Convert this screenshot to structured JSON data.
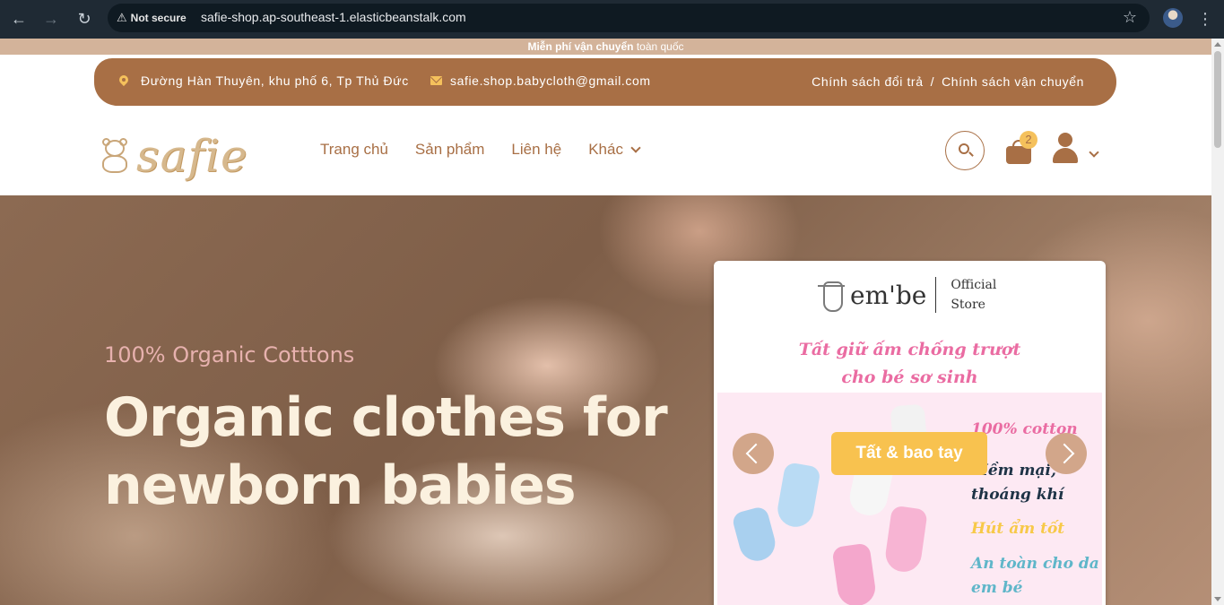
{
  "browser": {
    "security_label": "Not secure",
    "url": "safie-shop.ap-southeast-1.elasticbeanstalk.com"
  },
  "announcement": {
    "bold": "Miễn phí vận chuyển",
    "rest": " toàn quốc"
  },
  "infobar": {
    "address": "Đường Hàn Thuyên, khu phố 6, Tp Thủ Đức",
    "email": "safie.shop.babycloth@gmail.com",
    "policy_return": "Chính sách đổi trả",
    "policy_separator": "/",
    "policy_shipping": "Chính sách vận chuyển"
  },
  "header": {
    "logo_text": "safie",
    "nav": [
      "Trang chủ",
      "Sản phẩm",
      "Liên hệ",
      "Khác"
    ],
    "cart_count": "2"
  },
  "hero": {
    "subtitle": "100% Organic Cotttons",
    "title_line1": "Organic clothes for",
    "title_line2": "newborn babies"
  },
  "promo_card": {
    "brand": "em'be",
    "official_line1": "Official",
    "official_line2": "Store",
    "headline_line1": "Tất giữ ấm chống trượt",
    "headline_line2": "cho bé sơ sinh",
    "features": [
      {
        "text": "100% cotton",
        "color": "#ea6ca2"
      },
      {
        "text": "Mềm mại,",
        "color": "#1e3346"
      },
      {
        "text": "thoáng khí",
        "color": "#1e3346"
      },
      {
        "text": "Hút ẩm tốt",
        "color": "#f7c948"
      },
      {
        "text": "An toàn cho da",
        "color": "#5fb6c9"
      },
      {
        "text": "em bé",
        "color": "#5fb6c9"
      }
    ],
    "button_label": "Tất & bao tay"
  },
  "colors": {
    "brand_brown": "#a86f45",
    "accent_yellow": "#f5c15c",
    "announcement_bg": "#d3b39a"
  }
}
